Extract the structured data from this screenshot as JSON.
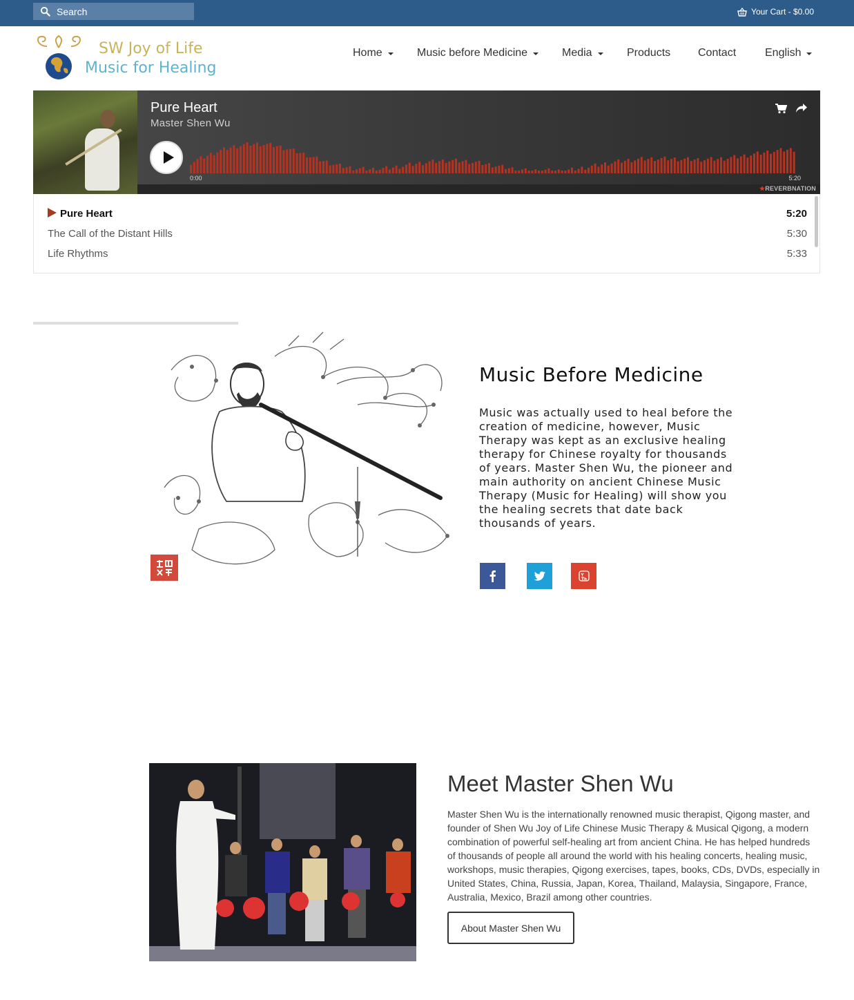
{
  "topbar": {
    "search_placeholder": "Search",
    "cart_label": "Your Cart - $0.00"
  },
  "logo": {
    "line1": "SW Joy of Life",
    "line2": "Music for Healing"
  },
  "nav": {
    "items": [
      {
        "label": "Home",
        "dropdown": true
      },
      {
        "label": "Music before Medicine",
        "dropdown": true
      },
      {
        "label": "Media",
        "dropdown": true
      },
      {
        "label": "Products",
        "dropdown": false
      },
      {
        "label": "Contact",
        "dropdown": false
      },
      {
        "label": "English",
        "dropdown": true
      }
    ]
  },
  "player": {
    "title": "Pure Heart",
    "artist": "Master Shen Wu",
    "time_start": "0:00",
    "time_end": "5:20",
    "brand": "REVERBNATION",
    "brand_star": "★",
    "waveform_color": "#b8321f",
    "icons": [
      "cart-icon",
      "share-icon",
      "play-icon"
    ]
  },
  "playlist": {
    "tracks": [
      {
        "title": "Pure Heart",
        "duration": "5:20",
        "active": true
      },
      {
        "title": "The Call of the Distant Hills",
        "duration": "5:30",
        "active": false
      },
      {
        "title": "Life Rhythms",
        "duration": "5:33",
        "active": false
      }
    ]
  },
  "mbm": {
    "title": "Music Before Medicine",
    "text": "Music was actually used to heal before the creation of medicine, however, Music Therapy was kept as an exclusive healing therapy for Chinese royalty for thousands of years. Master Shen Wu, the pioneer and main authority on ancient Chinese Music Therapy (Music for Healing) will show you the healing secrets that date back thousands of years.",
    "social": [
      {
        "name": "facebook",
        "color": "#3b5998"
      },
      {
        "name": "twitter",
        "color": "#1da1d8"
      },
      {
        "name": "youtube",
        "color": "#d9432f"
      }
    ]
  },
  "meet": {
    "title": "Meet Master Shen Wu",
    "text": "Master Shen Wu is the internationally renowned music therapist, Qigong master, and founder of Shen Wu Joy of Life Chinese Music Therapy & Musical Qigong, a modern combination of powerful self-healing art from ancient China. He has helped hundreds of thousands of people all around the world with his healing concerts, healing music, workshops, music therapies, Qigong exercises, tapes, books, CDs, DVDs, especially in United States, China, Russia, Japan, Korea, Thailand, Malaysia, Singapore, France, Australia, Mexico, Brazil among other countries.",
    "button_label": "About Master Shen Wu"
  },
  "colors": {
    "topbar": "#2e5c8a",
    "accent_red": "#a93a22"
  }
}
